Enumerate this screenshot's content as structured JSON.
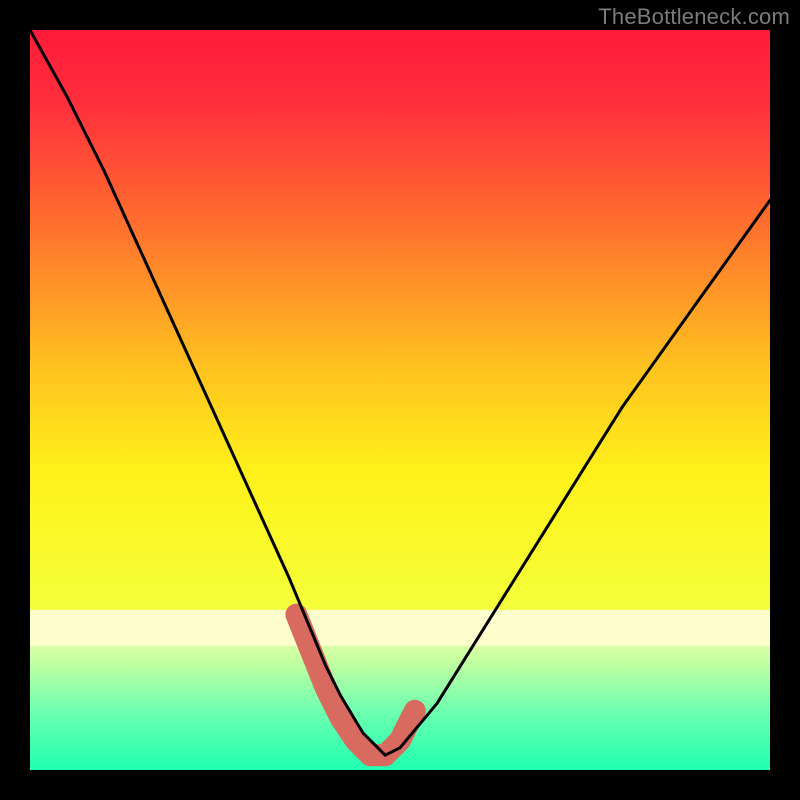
{
  "watermark": "TheBottleneck.com",
  "chart_data": {
    "type": "line",
    "title": "",
    "xlabel": "",
    "ylabel": "",
    "xlim": [
      0,
      100
    ],
    "ylim": [
      0,
      100
    ],
    "grid": false,
    "legend": false,
    "gradient_stops": [
      {
        "offset": 0,
        "color": "#ff1a3a"
      },
      {
        "offset": 0.1,
        "color": "#ff2f3c"
      },
      {
        "offset": 0.25,
        "color": "#ff6a2f"
      },
      {
        "offset": 0.45,
        "color": "#ffc020"
      },
      {
        "offset": 0.6,
        "color": "#fff21a"
      },
      {
        "offset": 0.78,
        "color": "#f4ff3a"
      },
      {
        "offset": 0.8,
        "color": "#fbffb0"
      },
      {
        "offset": 0.85,
        "color": "#c7ffa0"
      },
      {
        "offset": 0.92,
        "color": "#6fffb0"
      },
      {
        "offset": 1.0,
        "color": "#1fffb0"
      }
    ],
    "series": [
      {
        "name": "bottleneck-curve",
        "x": [
          0,
          5,
          10,
          15,
          20,
          25,
          30,
          35,
          40,
          42,
          45,
          48,
          50,
          55,
          60,
          65,
          70,
          75,
          80,
          85,
          90,
          95,
          100
        ],
        "values": [
          100,
          91,
          81,
          70,
          59,
          48,
          37,
          26,
          14,
          10,
          5,
          2,
          3,
          9,
          17,
          25,
          33,
          41,
          49,
          56,
          63,
          70,
          77
        ]
      },
      {
        "name": "highlight-band",
        "x": [
          36,
          38,
          40,
          42,
          44,
          46,
          48,
          50,
          52
        ],
        "values": [
          21,
          16,
          11,
          7,
          4,
          2,
          2,
          4,
          8
        ]
      }
    ],
    "highlight_color": "#d86a60",
    "curve_color": "#000000"
  }
}
